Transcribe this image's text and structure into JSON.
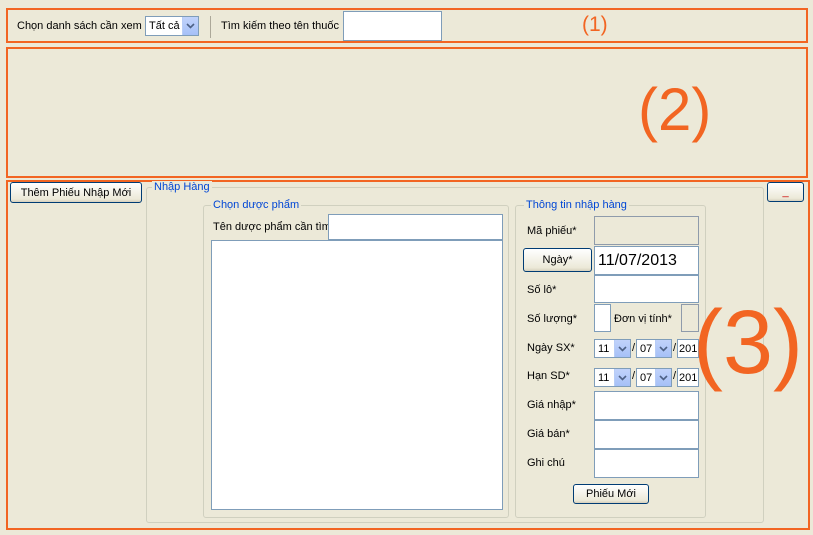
{
  "region_labels": {
    "r1": "(1)",
    "r2": "(2)",
    "r3": "(3)"
  },
  "filter_bar": {
    "list_label": "Chọn danh sách cần xem",
    "list_select_value": "Tất cả",
    "search_label": "Tìm kiếm theo tên thuốc",
    "search_value": ""
  },
  "actions": {
    "add_receipt_button": "Thêm Phiếu Nhập Mới",
    "minimize_button": "_"
  },
  "import_panel": {
    "title": "Nhập Hàng",
    "choose_product": {
      "legend": "Chọn dược phẩm",
      "search_label": "Tên dược phẩm cần tìm",
      "search_value": ""
    },
    "import_info": {
      "legend": "Thông tin nhập hàng",
      "receipt_code_label": "Mã phiếu*",
      "date_button": "Ngày*",
      "date_value": "11/07/2013",
      "lot_label": "Số lô*",
      "quantity_label": "Số lượng*",
      "unit_label": "Đơn vị tính*",
      "mfg_date_label": "Ngày SX*",
      "mfg_day": "11",
      "mfg_month": "07",
      "mfg_year": "201",
      "exp_date_label": "Hạn SD*",
      "exp_day": "11",
      "exp_month": "07",
      "exp_year": "201",
      "import_price_label": "Giá nhập*",
      "sale_price_label": "Giá bán*",
      "note_label": "Ghi chú",
      "new_receipt_button": "Phiếu Mới",
      "date_sep": "/"
    }
  },
  "colors": {
    "annotation": "#f26522",
    "legend": "#0046d5",
    "window_bg": "#ece9d8"
  }
}
